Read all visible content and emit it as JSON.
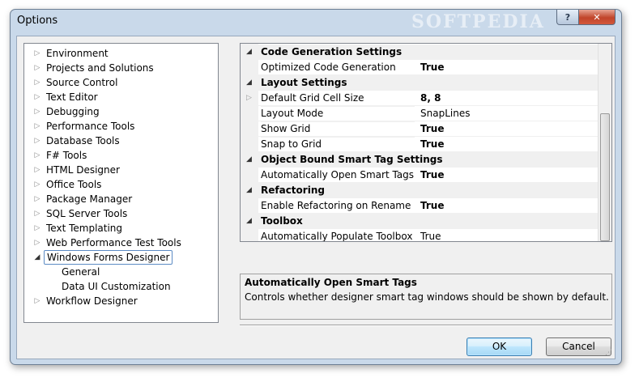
{
  "window": {
    "title": "Options",
    "watermark": "SOFTPEDIA",
    "help_label": "?",
    "close_label": "✕"
  },
  "tree": {
    "items": [
      {
        "label": "Environment",
        "level": 0,
        "state": "collapsed"
      },
      {
        "label": "Projects and Solutions",
        "level": 0,
        "state": "collapsed"
      },
      {
        "label": "Source Control",
        "level": 0,
        "state": "collapsed"
      },
      {
        "label": "Text Editor",
        "level": 0,
        "state": "collapsed"
      },
      {
        "label": "Debugging",
        "level": 0,
        "state": "collapsed"
      },
      {
        "label": "Performance Tools",
        "level": 0,
        "state": "collapsed"
      },
      {
        "label": "Database Tools",
        "level": 0,
        "state": "collapsed"
      },
      {
        "label": "F# Tools",
        "level": 0,
        "state": "collapsed"
      },
      {
        "label": "HTML Designer",
        "level": 0,
        "state": "collapsed"
      },
      {
        "label": "Office Tools",
        "level": 0,
        "state": "collapsed"
      },
      {
        "label": "Package Manager",
        "level": 0,
        "state": "collapsed"
      },
      {
        "label": "SQL Server Tools",
        "level": 0,
        "state": "collapsed"
      },
      {
        "label": "Text Templating",
        "level": 0,
        "state": "collapsed"
      },
      {
        "label": "Web Performance Test Tools",
        "level": 0,
        "state": "collapsed"
      },
      {
        "label": "Windows Forms Designer",
        "level": 0,
        "state": "expanded",
        "selected": true
      },
      {
        "label": "General",
        "level": 1,
        "state": "leaf"
      },
      {
        "label": "Data UI Customization",
        "level": 1,
        "state": "leaf"
      },
      {
        "label": "Workflow Designer",
        "level": 0,
        "state": "collapsed"
      }
    ]
  },
  "grid": {
    "rows": [
      {
        "kind": "category",
        "label": "Code Generation Settings"
      },
      {
        "kind": "property",
        "name": "Optimized Code Generation",
        "value": "True",
        "bold": true
      },
      {
        "kind": "category",
        "label": "Layout Settings"
      },
      {
        "kind": "property",
        "name": "Default Grid Cell Size",
        "value": "8, 8",
        "bold": true,
        "expandable": true
      },
      {
        "kind": "property",
        "name": "Layout Mode",
        "value": "SnapLines",
        "bold": false
      },
      {
        "kind": "property",
        "name": "Show Grid",
        "value": "True",
        "bold": true
      },
      {
        "kind": "property",
        "name": "Snap to Grid",
        "value": "True",
        "bold": true
      },
      {
        "kind": "category",
        "label": "Object Bound Smart Tag Settings"
      },
      {
        "kind": "property",
        "name": "Automatically Open Smart Tags",
        "value": "True",
        "bold": true
      },
      {
        "kind": "category",
        "label": "Refactoring"
      },
      {
        "kind": "property",
        "name": "Enable Refactoring on Rename",
        "value": "True",
        "bold": true
      },
      {
        "kind": "category",
        "label": "Toolbox"
      },
      {
        "kind": "property",
        "name": "Automatically Populate Toolbox",
        "value": "True",
        "bold": false
      }
    ]
  },
  "description": {
    "title": "Automatically Open Smart Tags",
    "text": "Controls whether designer smart tag windows should be shown by default."
  },
  "buttons": {
    "ok_label": "OK",
    "cancel_label": "Cancel"
  }
}
